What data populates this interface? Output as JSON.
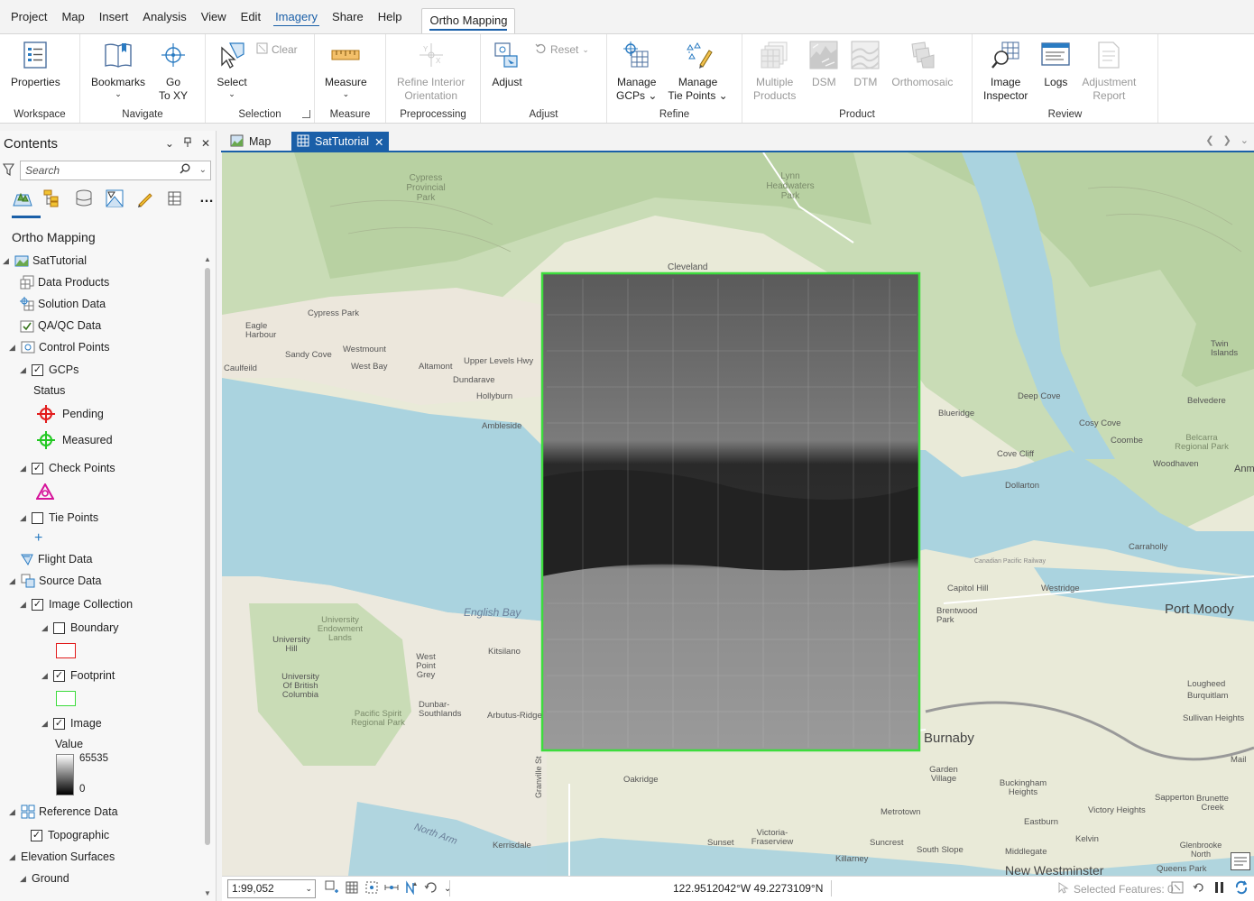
{
  "menu": {
    "tabs": [
      "Project",
      "Map",
      "Insert",
      "Analysis",
      "View",
      "Edit"
    ],
    "imagery": "Imagery",
    "tabs2": [
      "Share",
      "Help"
    ],
    "active_tab": "Ortho Mapping"
  },
  "ribbon": {
    "workspace": {
      "label": "Workspace",
      "properties": "Properties"
    },
    "navigate": {
      "label": "Navigate",
      "bookmarks": "Bookmarks",
      "go_to_xy_1": "Go",
      "go_to_xy_2": "To XY"
    },
    "selection": {
      "label": "Selection",
      "select": "Select",
      "clear": "Clear"
    },
    "measure": {
      "label": "Measure",
      "measure": "Measure"
    },
    "preprocessing": {
      "label": "Preprocessing",
      "refine_1": "Refine Interior",
      "refine_2": "Orientation"
    },
    "adjust": {
      "label": "Adjust",
      "adjust": "Adjust",
      "reset": "Reset"
    },
    "refine": {
      "label": "Refine",
      "manage_gcps_1": "Manage",
      "manage_gcps_2": "GCPs",
      "manage_tie_1": "Manage",
      "manage_tie_2": "Tie Points"
    },
    "product": {
      "label": "Product",
      "multiple_1": "Multiple",
      "multiple_2": "Products",
      "dsm": "DSM",
      "dtm": "DTM",
      "orthomosaic": "Orthomosaic"
    },
    "review": {
      "label": "Review",
      "inspector_1": "Image",
      "inspector_2": "Inspector",
      "logs": "Logs",
      "adj_report_1": "Adjustment",
      "adj_report_2": "Report"
    }
  },
  "contents": {
    "title": "Contents",
    "search_placeholder": "Search",
    "group_title": "Ortho Mapping",
    "tree": {
      "sattutorial": "SatTutorial",
      "data_products": "Data Products",
      "solution_data": "Solution Data",
      "qaqc_data": "QA/QC Data",
      "control_points": "Control Points",
      "gcps": "GCPs",
      "status": "Status",
      "pending": "Pending",
      "measured": "Measured",
      "check_points": "Check Points",
      "tie_points": "Tie Points",
      "flight_data": "Flight Data",
      "source_data": "Source Data",
      "image_collection": "Image Collection",
      "boundary": "Boundary",
      "footprint": "Footprint",
      "image": "Image",
      "value": "Value",
      "value_max": "65535",
      "value_min": "0",
      "reference_data": "Reference Data",
      "topographic": "Topographic",
      "elevation_surfaces": "Elevation Surfaces",
      "ground": "Ground"
    }
  },
  "doc_tabs": {
    "map": "Map",
    "sat": "SatTutorial"
  },
  "map": {
    "labels": [
      "Cypress Provincial Park",
      "Lynn Headwaters Park",
      "Cleveland",
      "Cypress Park",
      "Eagle Harbour",
      "Sandy Cove",
      "Westmount",
      "West Bay",
      "Caulfeild",
      "Altamont",
      "Upper Levels Hwy",
      "Dundarave",
      "Hollyburn",
      "Ambleside",
      "Blueridge",
      "Deep Cove",
      "Cosy Cove",
      "Coombe",
      "Belcarra Regional Park",
      "Woodhaven",
      "Cove Cliff",
      "Dollarton",
      "Carraholly",
      "Belvedere",
      "Twin Islands",
      "Canadian Pacific Railway",
      "Capitol Hill",
      "Westridge",
      "Port Moody",
      "Brentwood Park",
      "English Bay",
      "University Endowment Lands",
      "University Hill",
      "University Of British Columbia",
      "Kitsilano",
      "West Point Grey",
      "Pacific Spirit Regional Park",
      "Dunbar-Southlands",
      "Arbutus-Ridge",
      "Burnaby",
      "Lougheed",
      "Burquitlam",
      "Sullivan Heights",
      "Garden Village",
      "Oakridge",
      "Granville St",
      "Buckingham Heights",
      "Sapperton",
      "Brunette Creek",
      "Victory Heights",
      "Eastburn",
      "Metrotown",
      "Kelvin",
      "Sunset",
      "Victoria-Fraserview",
      "Suncrest",
      "South Slope",
      "Middlegate",
      "Kerrisdale",
      "North Arm",
      "Killarney",
      "Glenbrooke North",
      "New Westminster",
      "Queens Park",
      "Anmore",
      "Mail"
    ]
  },
  "status": {
    "scale": "1:99,052",
    "coords": "122.9512042°W 49.2273109°N",
    "selected_features": "Selected Features: 0"
  },
  "colors": {
    "accent": "#1a5fa8",
    "footprint": "#3ddc3d",
    "pending": "#e21c1c",
    "measured": "#22c822",
    "check": "#d6139a"
  }
}
